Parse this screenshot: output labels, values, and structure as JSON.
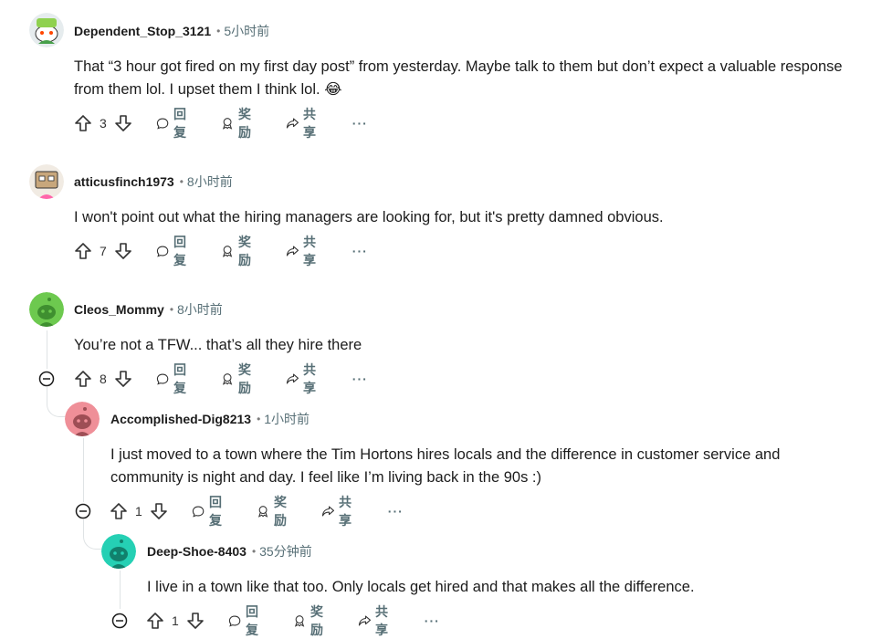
{
  "actions": {
    "reply": "回复",
    "award": "奖励",
    "share": "共享",
    "more": "···"
  },
  "comments": [
    {
      "author": "Dependent_Stop_3121",
      "time": "5小时前",
      "body": "That “3 hour got fired on my first day post” from yesterday. Maybe talk to them but don’t expect a valuable response from them lol. I upset them I think lol. 😂",
      "votes": "3",
      "avatar_color": "#e6ecee"
    },
    {
      "author": "atticusfinch1973",
      "time": "8小时前",
      "body": "I won't point out what the hiring managers are looking for, but it's pretty damned obvious.",
      "votes": "7",
      "avatar_color": "#e8ddd0"
    },
    {
      "author": "Cleos_Mommy",
      "time": "8小时前",
      "body": "You’re not a TFW... that’s all they hire there",
      "votes": "8",
      "avatar_color": "#6dc94f"
    },
    {
      "author": "Accomplished-Dig8213",
      "time": "1小时前",
      "body": "I just moved to a town where the Tim Hortons hires locals and the difference in customer service and community is night and day. I feel like I’m living back in the 90s :)",
      "votes": "1",
      "avatar_color": "#ef8f98"
    },
    {
      "author": "Deep-Shoe-8403",
      "time": "35分钟前",
      "body": "I live in a town like that too. Only locals get hired and that makes all the difference.",
      "votes": "1",
      "avatar_color": "#25d0b4"
    }
  ]
}
